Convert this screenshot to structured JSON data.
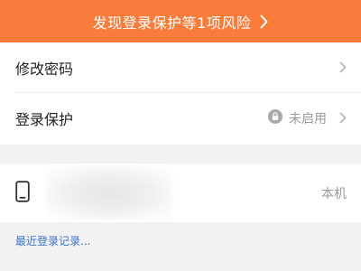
{
  "banner": {
    "text": "发现登录保护等1项风险",
    "chevron_icon": "chevron-right-icon",
    "color": "#fa7c3a"
  },
  "security": {
    "change_password": {
      "label": "修改密码",
      "chevron_icon": "chevron-right-icon"
    },
    "login_protection": {
      "label": "登录保护",
      "status_icon": "lock-icon",
      "status": "未启用",
      "chevron_icon": "chevron-right-icon"
    }
  },
  "device": {
    "icon": "phone-icon",
    "tag": "本机"
  },
  "recent_login_link": "最近登录记录...",
  "colors": {
    "accent_orange": "#fa7c3a",
    "link_blue": "#3a74c8",
    "muted_gray": "#9a9a9a"
  }
}
